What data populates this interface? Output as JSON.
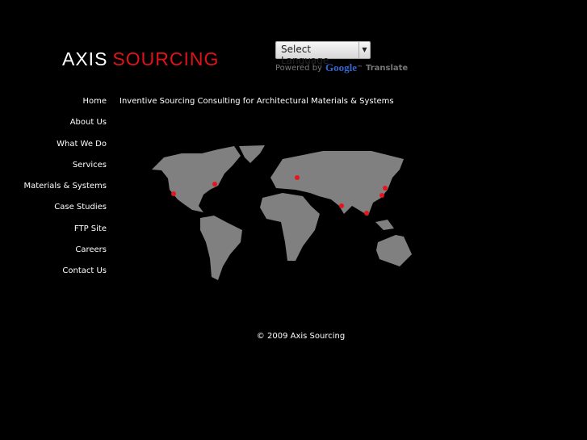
{
  "logo": {
    "part1": "AXIS",
    "part2": "SOURCING"
  },
  "language": {
    "selected": "Select Language",
    "powered_by": "Powered by",
    "google": "Google",
    "tm": "™",
    "translate": "Translate"
  },
  "nav": [
    "Home",
    "About Us",
    "What We Do",
    "Services",
    "Materials & Systems",
    "Case Studies",
    "FTP Site",
    "Careers",
    "Contact Us"
  ],
  "tagline": "Inventive Sourcing Consulting for Architectural Materials & Systems",
  "footer": "© 2009 Axis Sourcing",
  "colors": {
    "accent": "#e0111b",
    "map": "#808080"
  }
}
